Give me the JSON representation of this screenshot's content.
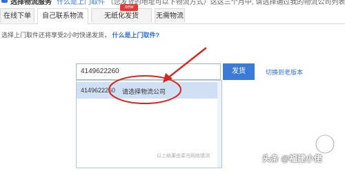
{
  "header": {
    "title": "选择物流服务",
    "note_link": "什么是上门取件",
    "note_text": "（您发货的地址可以下物流方式）这这三个月中, 请选择通过我的物流公司列表"
  },
  "tabs": [
    {
      "label": "在线下单"
    },
    {
      "label": "自己联系物流"
    },
    {
      "label": "无纸化发货"
    },
    {
      "label": "无需物流"
    }
  ],
  "badge": "new",
  "tip": {
    "text": "选择上门取件还将享受2小时快递发货，",
    "link": "什么是上门取件?"
  },
  "search": {
    "value": "4149622260"
  },
  "send_button": "发货",
  "old_version_link": "切换到老版本",
  "dropdown": {
    "row_number": "4149622260",
    "row_carrier": "请选择物流公司",
    "hint": "以上结果由菜鸟网络猜测"
  },
  "watermark": "头条 @福建小佬",
  "colors": {
    "accent": "#3a7bd5",
    "highlight_row": "#cfe0f5",
    "annotation_red": "#d9261c",
    "badge_red": "#e4393c"
  }
}
